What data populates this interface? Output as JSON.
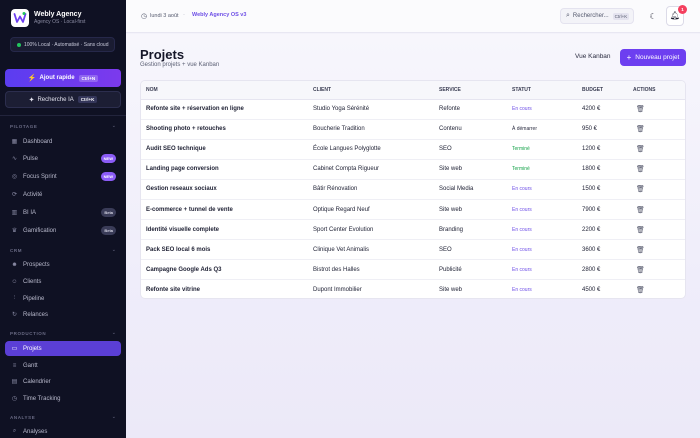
{
  "sidebar": {
    "brand_name": "Webly Agency",
    "brand_sub": "Agency OS · Local-first",
    "local_pill": "100% Local · Automatisé · Sans cloud",
    "quick_add": {
      "label": "Ajout rapide",
      "shortcut": "Ctrl+N"
    },
    "ai_search": {
      "label": "Recherche IA",
      "shortcut": "Ctrl+K"
    },
    "sections": {
      "pilotage": "PILOTAGE",
      "crm": "CRM",
      "production": "PRODUCTION",
      "analyse": "ANALYSE"
    },
    "items": {
      "dashboard": "Dashboard",
      "pulse": "Pulse",
      "focus_sprint": "Focus Sprint",
      "activite": "Activité",
      "bi_ia": "BI IA",
      "gamification": "Gamification",
      "prospects": "Prospects",
      "clients": "Clients",
      "pipeline": "Pipeline",
      "relances": "Relances",
      "projets": "Projets",
      "gantt": "Gantt",
      "calendrier": "Calendrier",
      "time_tracking": "Time Tracking",
      "analyses": "Analyses"
    },
    "badges": {
      "new": "NEW",
      "beta": "Beta"
    }
  },
  "topbar": {
    "date": "lundi 3 août",
    "separator": "·",
    "app_version": "Webly Agency OS v3",
    "search_placeholder": "Rechercher...",
    "search_shortcut": "Ctrl+K",
    "notifications_count": "1"
  },
  "page": {
    "title": "Projets",
    "subtitle": "Gestion projets + vue Kanban",
    "kanban_button": "Vue Kanban",
    "new_button": "Nouveau projet"
  },
  "table": {
    "headers": {
      "nom": "NOM",
      "client": "CLIENT",
      "service": "SERVICE",
      "statut": "STATUT",
      "budget": "BUDGET",
      "actions": "ACTIONS"
    },
    "rows": [
      {
        "nom": "Refonte site + réservation en ligne",
        "client": "Studio Yoga Sérénité",
        "service": "Refonte",
        "statut": "En cours",
        "status_kind": "cours",
        "budget": "4200 €"
      },
      {
        "nom": "Shooting photo + retouches",
        "client": "Boucherie Tradition",
        "service": "Contenu",
        "statut": "À démarrer",
        "status_kind": "demarrer",
        "budget": "950 €"
      },
      {
        "nom": "Audit SEO technique",
        "client": "École Langues Polyglotte",
        "service": "SEO",
        "statut": "Terminé",
        "status_kind": "termine",
        "budget": "1200 €"
      },
      {
        "nom": "Landing page conversion",
        "client": "Cabinet Compta Rigueur",
        "service": "Site web",
        "statut": "Terminé",
        "status_kind": "termine",
        "budget": "1800 €"
      },
      {
        "nom": "Gestion reseaux sociaux",
        "client": "Bâtir Rénovation",
        "service": "Social Media",
        "statut": "En cours",
        "status_kind": "cours",
        "budget": "1500 €"
      },
      {
        "nom": "E-commerce + tunnel de vente",
        "client": "Optique Regard Neuf",
        "service": "Site web",
        "statut": "En cours",
        "status_kind": "cours",
        "budget": "7900 €"
      },
      {
        "nom": "Identité visuelle complete",
        "client": "Sport Center Evolution",
        "service": "Branding",
        "statut": "En cours",
        "status_kind": "cours",
        "budget": "2200 €"
      },
      {
        "nom": "Pack SEO local 6 mois",
        "client": "Clinique Vet Animalis",
        "service": "SEO",
        "statut": "En cours",
        "status_kind": "cours",
        "budget": "3600 €"
      },
      {
        "nom": "Campagne Google Ads Q3",
        "client": "Bistrot des Halles",
        "service": "Publicité",
        "statut": "En cours",
        "status_kind": "cours",
        "budget": "2800 €"
      },
      {
        "nom": "Refonte site vitrine",
        "client": "Dupont Immobilier",
        "service": "Site web",
        "statut": "En cours",
        "status_kind": "cours",
        "budget": "4500 €"
      }
    ]
  },
  "colors": {
    "sidebar_bg": "#0f1123",
    "accent": "#6d3ff0",
    "status_in_progress": "#6d4ee6",
    "status_done": "#16a34a"
  }
}
